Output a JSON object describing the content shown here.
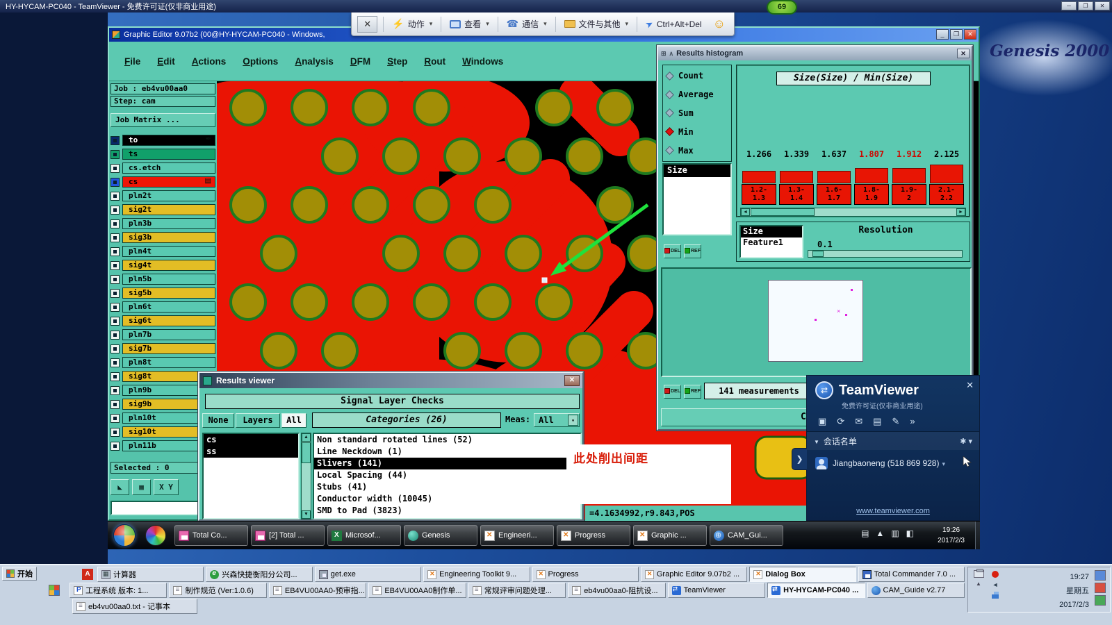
{
  "host": {
    "title": "HY-HYCAM-PC040 - TeamViewer - 免费许可证(仅非商业用途)",
    "badge": "69",
    "toolbar": {
      "items": [
        {
          "label": "动作",
          "icon": "tb-bolt"
        },
        {
          "label": "查看",
          "icon": "tb-monitor"
        },
        {
          "label": "通信",
          "icon": "tb-headset"
        },
        {
          "label": "文件与其他",
          "icon": "tb-files"
        },
        {
          "label": "Ctrl+Alt+Del",
          "icon": "tb-plane"
        }
      ]
    },
    "taskbar": {
      "start": "开始",
      "row1": [
        {
          "label": "计算器",
          "icon": "hic-calc",
          "cls": ""
        },
        {
          "label": "兴森快捷衡阳分公司...",
          "icon": "hic-e",
          "cls": ""
        },
        {
          "label": "get.exe",
          "icon": "hic-exe",
          "cls": ""
        },
        {
          "label": "Engineering Toolkit 9...",
          "icon": "hic-x",
          "cls": ""
        },
        {
          "label": "Progress",
          "icon": "hic-x",
          "cls": ""
        },
        {
          "label": "Graphic Editor 9.07b2 ...",
          "icon": "hic-x",
          "cls": ""
        },
        {
          "label": "Dialog Box",
          "icon": "hic-x",
          "cls": "active"
        },
        {
          "label": "Total Commander 7.0 ...",
          "icon": "hic-tc",
          "cls": ""
        }
      ],
      "row2": [
        {
          "label": "工程系统 版本: 1...",
          "icon": "hic-p",
          "cls": ""
        },
        {
          "label": "制作规范 (Ver:1.0.6)",
          "icon": "hic-note",
          "cls": ""
        },
        {
          "label": "EB4VU00AA0-预审指...",
          "icon": "hic-note",
          "cls": ""
        },
        {
          "label": "EB4VU00AA0制作单...",
          "icon": "hic-note",
          "cls": ""
        },
        {
          "label": "常规评审问题处理...",
          "icon": "hic-note",
          "cls": ""
        },
        {
          "label": "eb4vu00aa0-阻抗设...",
          "icon": "hic-note",
          "cls": ""
        },
        {
          "label": "TeamViewer",
          "icon": "hic-tv",
          "cls": ""
        },
        {
          "label": "HY-HYCAM-PC040 ...",
          "icon": "hic-tv",
          "cls": "active"
        },
        {
          "label": "CAM_Guide v2.77",
          "icon": "hic-globe",
          "cls": ""
        }
      ],
      "row3": [
        {
          "label": "eb4vu00aa0.txt - 记事本",
          "icon": "hic-note",
          "cls": ""
        }
      ],
      "tray": {
        "time": "19:27",
        "weekday": "星期五",
        "date": "2017/2/3"
      }
    }
  },
  "desktop": {
    "wallpaper_text": "Genesis 2000"
  },
  "editor": {
    "title": "Graphic Editor 9.07b2 (00@HY-HYCAM-PC040 - Windows,",
    "menus": [
      "File",
      "Edit",
      "Actions",
      "Options",
      "Analysis",
      "DFM",
      "Step",
      "Rout",
      "Windows"
    ],
    "job": "Job : eb4vu00aa0",
    "step": "Step: cam",
    "job_matrix": "Job Matrix ...",
    "layers": [
      {
        "name": "to",
        "cls": "lay-black",
        "chk": "chk-dark",
        "tag": "✒"
      },
      {
        "name": "ts",
        "cls": "lay-green",
        "chk": "chk-green",
        "tag": ""
      },
      {
        "name": "cs.etch",
        "cls": "lay-teal",
        "chk": "",
        "tag": ""
      },
      {
        "name": "cs",
        "cls": "lay-red",
        "chk": "chk-blue",
        "tag": "▤"
      },
      {
        "name": "pln2t",
        "cls": "lay-teal",
        "chk": "",
        "tag": ""
      },
      {
        "name": "sig2t",
        "cls": "lay-yellow",
        "chk": "",
        "tag": ""
      },
      {
        "name": "pln3b",
        "cls": "lay-teal",
        "chk": "",
        "tag": ""
      },
      {
        "name": "sig3b",
        "cls": "lay-yellow",
        "chk": "",
        "tag": ""
      },
      {
        "name": "pln4t",
        "cls": "lay-teal",
        "chk": "",
        "tag": ""
      },
      {
        "name": "sig4t",
        "cls": "lay-yellow",
        "chk": "",
        "tag": ""
      },
      {
        "name": "pln5b",
        "cls": "lay-teal",
        "chk": "",
        "tag": ""
      },
      {
        "name": "sig5b",
        "cls": "lay-yellow",
        "chk": "",
        "tag": ""
      },
      {
        "name": "pln6t",
        "cls": "lay-teal",
        "chk": "",
        "tag": ""
      },
      {
        "name": "sig6t",
        "cls": "lay-yellow",
        "chk": "",
        "tag": ""
      },
      {
        "name": "pln7b",
        "cls": "lay-teal",
        "chk": "",
        "tag": ""
      },
      {
        "name": "sig7b",
        "cls": "lay-yellow",
        "chk": "",
        "tag": ""
      },
      {
        "name": "pln8t",
        "cls": "lay-teal",
        "chk": "",
        "tag": ""
      },
      {
        "name": "sig8t",
        "cls": "lay-yellow",
        "chk": "",
        "tag": ""
      },
      {
        "name": "pln9b",
        "cls": "lay-teal",
        "chk": "",
        "tag": ""
      },
      {
        "name": "sig9b",
        "cls": "lay-yellow",
        "chk": "",
        "tag": ""
      },
      {
        "name": "pln10t",
        "cls": "lay-teal",
        "chk": "",
        "tag": ""
      },
      {
        "name": "sig10t",
        "cls": "lay-yellow",
        "chk": "",
        "tag": ""
      },
      {
        "name": "pln11b",
        "cls": "lay-teal",
        "chk": "",
        "tag": ""
      }
    ],
    "selected": "Selected : 0",
    "xy": "X Y",
    "status": "=4.1634992,r9.843,POS"
  },
  "histogram": {
    "title": "Results histogram",
    "stats": [
      {
        "label": "Count",
        "cls": ""
      },
      {
        "label": "Average",
        "cls": ""
      },
      {
        "label": "Sum",
        "cls": ""
      },
      {
        "label": "Min",
        "cls": "stat-sel"
      },
      {
        "label": "Max",
        "cls": ""
      }
    ],
    "size_item": "Size",
    "chart_title": "Size(Size) / Min(Size)",
    "values": [
      {
        "v": "1.266",
        "cls": ""
      },
      {
        "v": "1.339",
        "cls": ""
      },
      {
        "v": "1.637",
        "cls": ""
      },
      {
        "v": "1.807",
        "cls": "hl"
      },
      {
        "v": "1.912",
        "cls": "hl"
      },
      {
        "v": "2.125",
        "cls": ""
      }
    ],
    "bins": [
      {
        "top": "1.2-",
        "bot": "1.3"
      },
      {
        "top": "1.3-",
        "bot": "1.4"
      },
      {
        "top": "1.6-",
        "bot": "1.7"
      },
      {
        "top": "1.8-",
        "bot": "1.9"
      },
      {
        "top": "1.9-",
        "bot": "2"
      },
      {
        "top": "2.1-",
        "bot": "2.2"
      }
    ],
    "chart_data": {
      "type": "bar",
      "title": "Size(Size) / Min(Size)",
      "categories": [
        "1.2-1.3",
        "1.3-1.4",
        "1.6-1.7",
        "1.8-1.9",
        "1.9-2",
        "2.1-2.2"
      ],
      "values": [
        1.266,
        1.339,
        1.637,
        1.807,
        1.912,
        2.125
      ]
    },
    "feature_sel": "Size",
    "feature_plain": "Feature1",
    "resolution_label": "Resolution",
    "resolution_value": "0.1",
    "del": "DEL",
    "ref": "REF",
    "measurements": "141 measurements",
    "close_partial": "C"
  },
  "viewer": {
    "title": "Results viewer",
    "header": "Signal Layer Checks",
    "btn_none": "None",
    "btn_layers": "Layers",
    "btn_all": "All",
    "categories_header": "Categories (26)",
    "meas_label": "Meas:",
    "meas_value": "All",
    "layers": [
      {
        "label": "cs",
        "cls": "sel-row"
      },
      {
        "label": "ss",
        "cls": "sel-row"
      }
    ],
    "categories": [
      {
        "label": "Non standard rotated lines (52)",
        "cls": ""
      },
      {
        "label": "Line Neckdown (1)",
        "cls": ""
      },
      {
        "label": "Slivers (141)",
        "cls": "sel-row"
      },
      {
        "label": "Local Spacing (44)",
        "cls": ""
      },
      {
        "label": "Stubs (41)",
        "cls": ""
      },
      {
        "label": "Conductor width (10045)",
        "cls": ""
      },
      {
        "label": "SMD to Pad (3823)",
        "cls": ""
      }
    ]
  },
  "annotation": {
    "text": "此处削出间距"
  },
  "tv_panel": {
    "brand": "TeamViewer",
    "license": "免费许可证(仅非商业用途)",
    "session_list": "会话名单",
    "participant": "Jiangbaoneng (518 869 928)",
    "link": "www.teamviewer.com"
  },
  "remote_taskbar": {
    "items": [
      {
        "label": "Total Co...",
        "icon": "ic-floppy"
      },
      {
        "label": "[2] Total ...",
        "icon": "ic-floppy"
      },
      {
        "label": "Microsof...",
        "icon": "ic-excel"
      },
      {
        "label": "Genesis",
        "icon": "ic-genesis"
      },
      {
        "label": "Engineeri...",
        "icon": "ic-x"
      },
      {
        "label": "Progress",
        "icon": "ic-x"
      },
      {
        "label": "Graphic ...",
        "icon": "ic-x"
      },
      {
        "label": "CAM_Gui...",
        "icon": "ic-globe"
      }
    ],
    "time": "19:26",
    "date": "2017/2/3"
  }
}
